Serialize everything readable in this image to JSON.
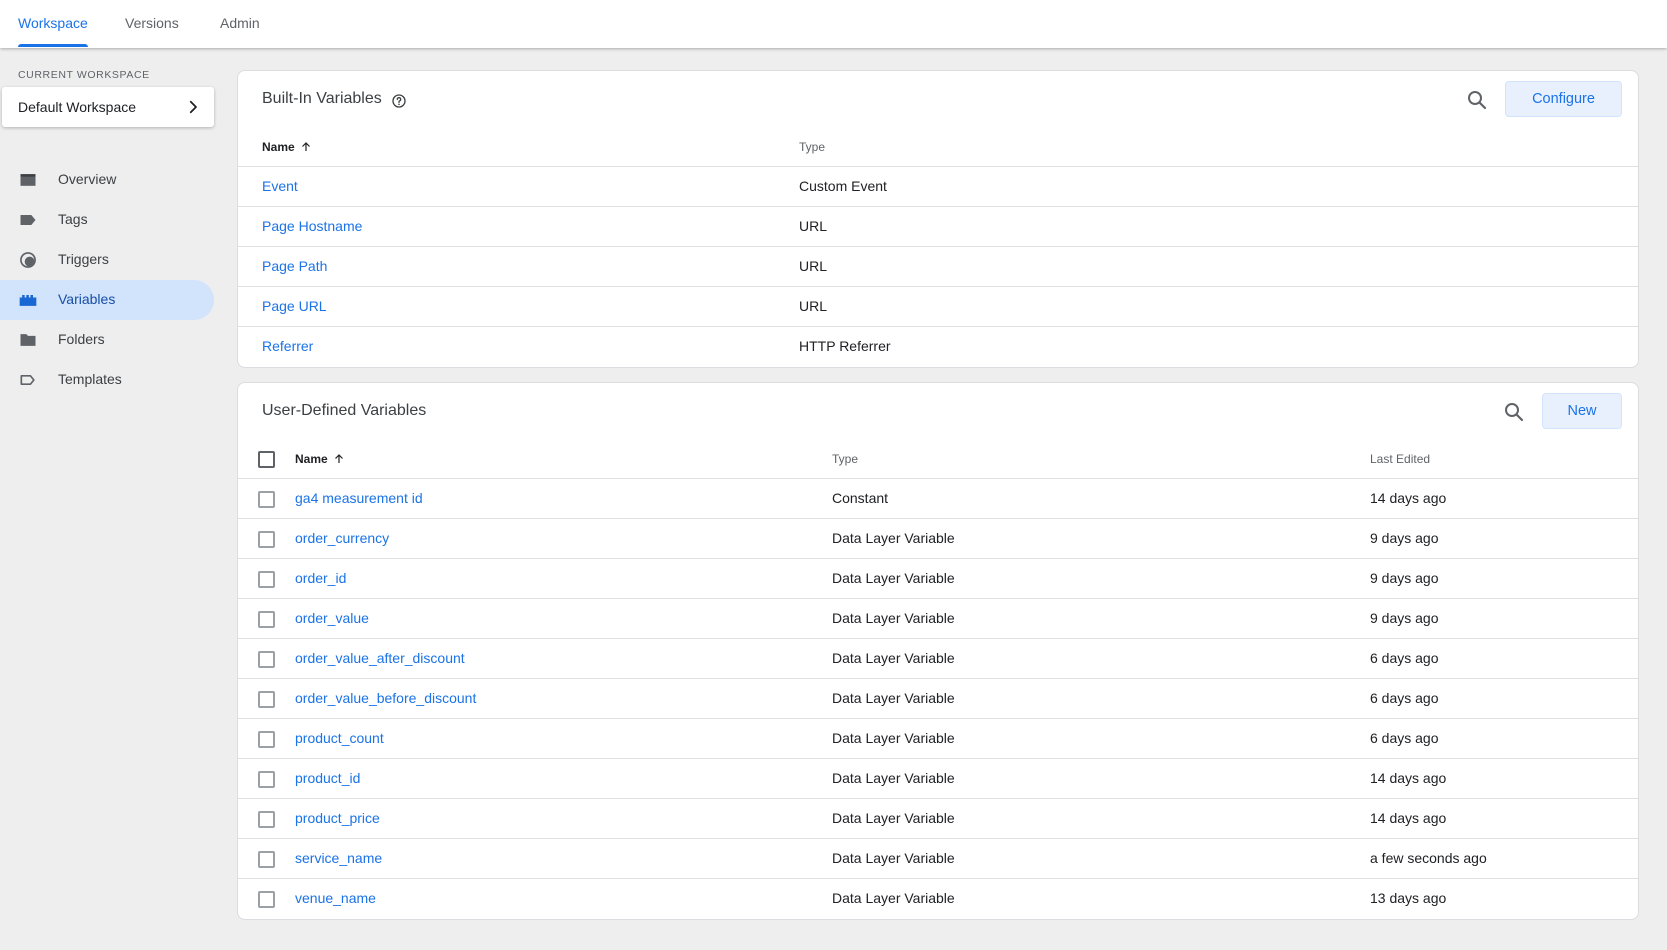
{
  "topnav": {
    "tabs": [
      {
        "label": "Workspace",
        "active": true
      },
      {
        "label": "Versions",
        "active": false
      },
      {
        "label": "Admin",
        "active": false
      }
    ]
  },
  "sidebar": {
    "workspace_label": "CURRENT WORKSPACE",
    "workspace_name": "Default Workspace",
    "items": [
      {
        "label": "Overview",
        "icon": "overview-icon",
        "active": false
      },
      {
        "label": "Tags",
        "icon": "tag-icon",
        "active": false
      },
      {
        "label": "Triggers",
        "icon": "trigger-icon",
        "active": false
      },
      {
        "label": "Variables",
        "icon": "variables-icon",
        "active": true
      },
      {
        "label": "Folders",
        "icon": "folder-icon",
        "active": false
      },
      {
        "label": "Templates",
        "icon": "template-icon",
        "active": false
      }
    ]
  },
  "builtin": {
    "title": "Built-In Variables",
    "configure_label": "Configure",
    "col_name": "Name",
    "col_type": "Type",
    "rows": [
      {
        "name": "Event",
        "type": "Custom Event"
      },
      {
        "name": "Page Hostname",
        "type": "URL"
      },
      {
        "name": "Page Path",
        "type": "URL"
      },
      {
        "name": "Page URL",
        "type": "URL"
      },
      {
        "name": "Referrer",
        "type": "HTTP Referrer"
      }
    ]
  },
  "userdefined": {
    "title": "User-Defined Variables",
    "new_label": "New",
    "col_name": "Name",
    "col_type": "Type",
    "col_edited": "Last Edited",
    "rows": [
      {
        "name": "ga4 measurement id",
        "type": "Constant",
        "edited": "14 days ago"
      },
      {
        "name": "order_currency",
        "type": "Data Layer Variable",
        "edited": "9 days ago"
      },
      {
        "name": "order_id",
        "type": "Data Layer Variable",
        "edited": "9 days ago"
      },
      {
        "name": "order_value",
        "type": "Data Layer Variable",
        "edited": "9 days ago"
      },
      {
        "name": "order_value_after_discount",
        "type": "Data Layer Variable",
        "edited": "6 days ago"
      },
      {
        "name": "order_value_before_discount",
        "type": "Data Layer Variable",
        "edited": "6 days ago"
      },
      {
        "name": "product_count",
        "type": "Data Layer Variable",
        "edited": "6 days ago"
      },
      {
        "name": "product_id",
        "type": "Data Layer Variable",
        "edited": "14 days ago"
      },
      {
        "name": "product_price",
        "type": "Data Layer Variable",
        "edited": "14 days ago"
      },
      {
        "name": "service_name",
        "type": "Data Layer Variable",
        "edited": "a few seconds ago"
      },
      {
        "name": "venue_name",
        "type": "Data Layer Variable",
        "edited": "13 days ago"
      }
    ]
  },
  "colors": {
    "accent": "#1a73e8",
    "active_nav_bg": "#d2e3fc",
    "background": "#eeeeee"
  }
}
